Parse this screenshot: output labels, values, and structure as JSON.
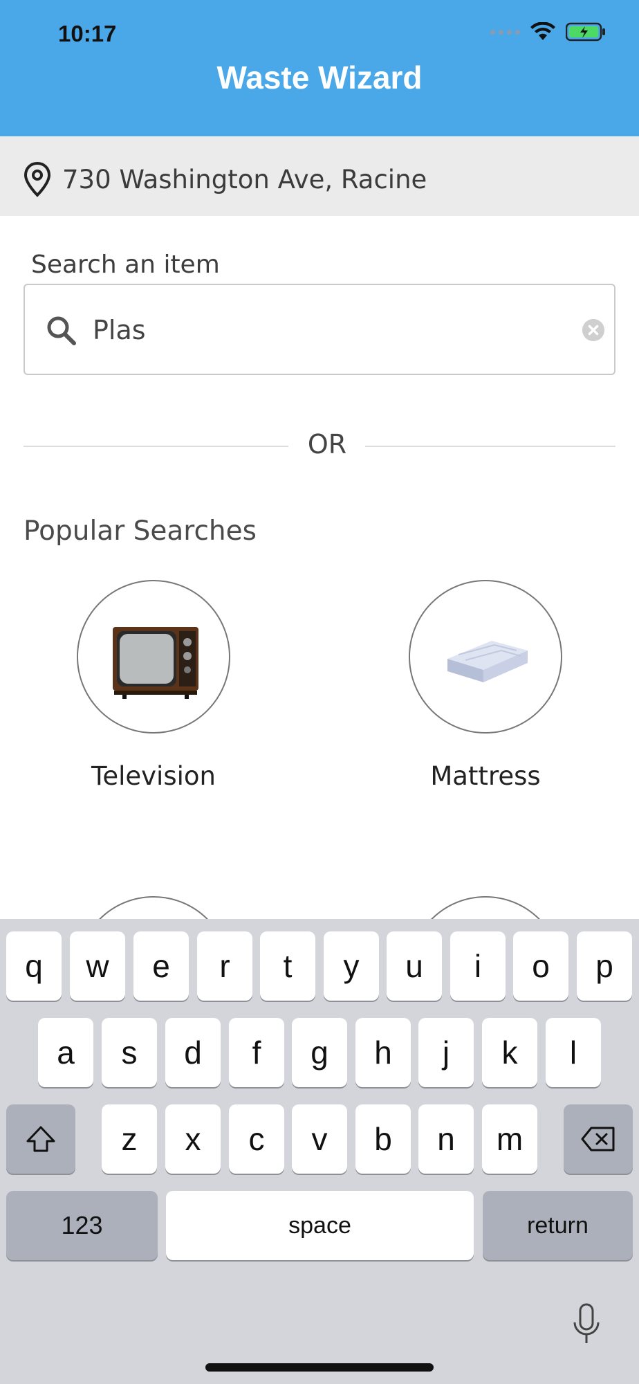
{
  "status_bar": {
    "time": "10:17"
  },
  "header": {
    "title": "Waste Wizard"
  },
  "location": {
    "address": "730 Washington Ave, Racine"
  },
  "search": {
    "label": "Search an item",
    "value": "Plas"
  },
  "divider": {
    "text": "OR"
  },
  "popular": {
    "title": "Popular Searches",
    "items": [
      {
        "label": "Television",
        "icon": "television-icon"
      },
      {
        "label": "Mattress",
        "icon": "mattress-icon"
      }
    ]
  },
  "keyboard": {
    "row1": [
      "q",
      "w",
      "e",
      "r",
      "t",
      "y",
      "u",
      "i",
      "o",
      "p"
    ],
    "row2": [
      "a",
      "s",
      "d",
      "f",
      "g",
      "h",
      "j",
      "k",
      "l"
    ],
    "row3": [
      "z",
      "x",
      "c",
      "v",
      "b",
      "n",
      "m"
    ],
    "numbers_label": "123",
    "space_label": "space",
    "return_label": "return"
  },
  "colors": {
    "header": "#4aa8e8",
    "location_bar": "#ebebeb",
    "keyboard": "#d3d5da"
  }
}
